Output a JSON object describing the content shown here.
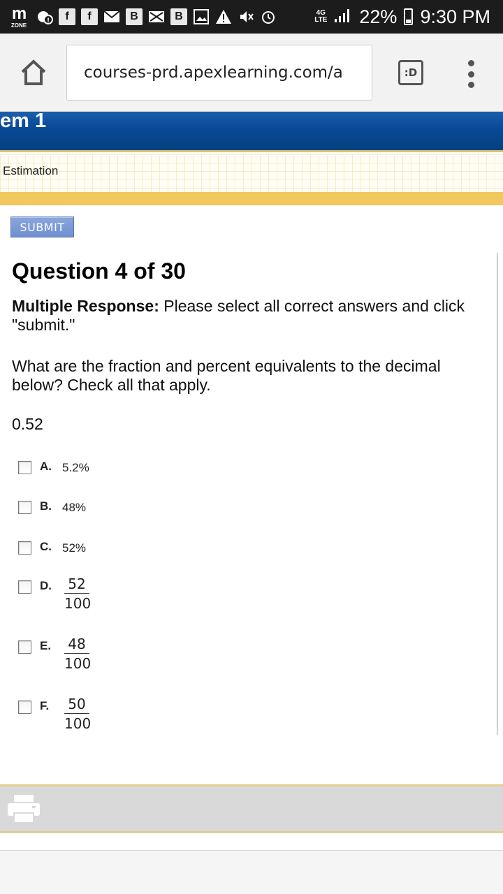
{
  "status_bar": {
    "logo_text": "m",
    "logo_sub": "ZONE",
    "icons": [
      "notification-icon",
      "facebook-icon",
      "facebook-icon",
      "mail-icon",
      "bold-b-icon",
      "mail-x-icon",
      "bold-b-icon",
      "image-icon",
      "warning-icon",
      "mute-icon",
      "alarm-icon",
      "4g-lte-icon",
      "signal-icon",
      "battery-icon"
    ],
    "network": "4G\nLTE",
    "battery": "22%",
    "time": "9:30 PM"
  },
  "browser": {
    "url": "courses-prd.apexlearning.com/a",
    "tabs_label": ":D"
  },
  "course": {
    "title": "em 1",
    "lesson": "Estimation",
    "submit_label": "SUBMIT"
  },
  "question": {
    "heading": "Question 4 of 30",
    "instruction_label": "Multiple Response:",
    "instruction_text": " Please select all correct answers and click \"submit.\"",
    "text": "What are the fraction and percent equivalents to the decimal below? Check all that apply.",
    "value": "0.52",
    "options": [
      {
        "letter": "A.",
        "text": "5.2%"
      },
      {
        "letter": "B.",
        "text": "48%"
      },
      {
        "letter": "C.",
        "text": "52%"
      },
      {
        "letter": "D.",
        "numerator": "52",
        "denominator": "100"
      },
      {
        "letter": "E.",
        "numerator": "48",
        "denominator": "100"
      },
      {
        "letter": "F.",
        "numerator": "50",
        "denominator": "100"
      }
    ]
  },
  "colors": {
    "header_blue": "#0a4a98",
    "gold": "#f1c75e",
    "submit_blue": "#7a98d6"
  }
}
